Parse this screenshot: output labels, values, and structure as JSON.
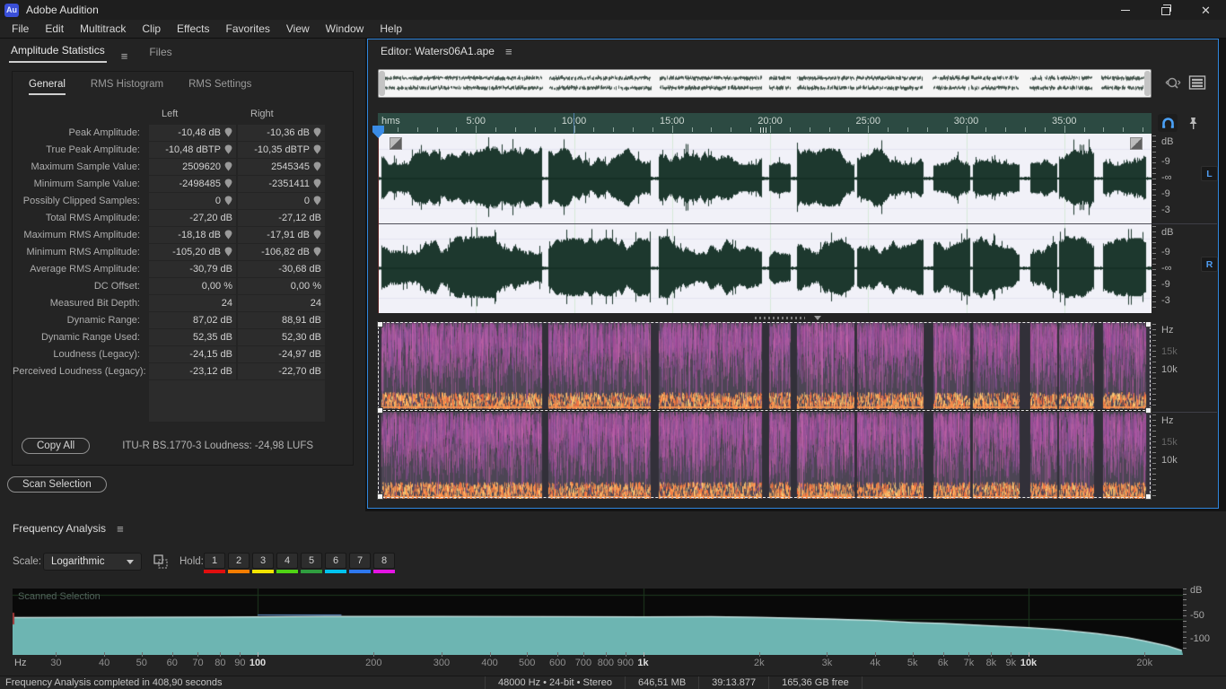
{
  "window": {
    "logo": "Au",
    "title": "Adobe Audition"
  },
  "menu": {
    "items": [
      "File",
      "Edit",
      "Multitrack",
      "Clip",
      "Effects",
      "Favorites",
      "View",
      "Window",
      "Help"
    ]
  },
  "stats_panel": {
    "tabs": [
      {
        "label": "Amplitude Statistics",
        "active": true
      },
      {
        "label": "Files",
        "active": false
      }
    ],
    "inner_tabs": [
      {
        "label": "General",
        "active": true
      },
      {
        "label": "RMS Histogram",
        "active": false
      },
      {
        "label": "RMS Settings",
        "active": false
      }
    ],
    "columns": {
      "left": "Left",
      "right": "Right"
    },
    "rows": [
      {
        "label": "Peak Amplitude:",
        "left": "-10,48 dB",
        "right": "-10,36 dB",
        "pins": true
      },
      {
        "label": "True Peak Amplitude:",
        "left": "-10,48 dBTP",
        "right": "-10,35 dBTP",
        "pins": true
      },
      {
        "label": "Maximum Sample Value:",
        "left": "2509620",
        "right": "2545345",
        "pins": true
      },
      {
        "label": "Minimum Sample Value:",
        "left": "-2498485",
        "right": "-2351411",
        "pins": true
      },
      {
        "label": "Possibly Clipped Samples:",
        "left": "0",
        "right": "0",
        "pins": true
      },
      {
        "label": "Total RMS Amplitude:",
        "left": "-27,20 dB",
        "right": "-27,12 dB",
        "pins": false
      },
      {
        "label": "Maximum RMS Amplitude:",
        "left": "-18,18 dB",
        "right": "-17,91 dB",
        "pins": true
      },
      {
        "label": "Minimum RMS Amplitude:",
        "left": "-105,20 dB",
        "right": "-106,82 dB",
        "pins": true
      },
      {
        "label": "Average RMS Amplitude:",
        "left": "-30,79 dB",
        "right": "-30,68 dB",
        "pins": false
      },
      {
        "label": "DC Offset:",
        "left": "0,00 %",
        "right": "0,00 %",
        "pins": false
      },
      {
        "label": "Measured Bit Depth:",
        "left": "24",
        "right": "24",
        "pins": false
      },
      {
        "label": "Dynamic Range:",
        "left": "87,02 dB",
        "right": "88,91 dB",
        "pins": false
      },
      {
        "label": "Dynamic Range Used:",
        "left": "52,35 dB",
        "right": "52,30 dB",
        "pins": false
      },
      {
        "label": "Loudness (Legacy):",
        "left": "-24,15 dB",
        "right": "-24,97 dB",
        "pins": false
      },
      {
        "label": "Perceived Loudness (Legacy):",
        "left": "-23,12 dB",
        "right": "-22,70 dB",
        "pins": false
      }
    ],
    "copy_all_label": "Copy All",
    "loudness_note": "ITU-R BS.1770-3 Loudness:  -24,98 LUFS",
    "scan_selection_label": "Scan Selection"
  },
  "editor": {
    "title": "Editor: Waters06A1.ape",
    "duration_min": 39.45,
    "timeline": {
      "unit": "hms",
      "major_labels": [
        "5:00",
        "10:00",
        "15:00",
        "20:00",
        "25:00",
        "30:00",
        "35:00"
      ]
    },
    "wave_scale": {
      "unit": "dB",
      "labels": [
        "-9",
        "-∞",
        "-9",
        "-3"
      ]
    },
    "channels": [
      "L",
      "R"
    ],
    "spectral_scale": {
      "unit": "Hz",
      "labels": [
        {
          "text": "15k",
          "dim": true
        },
        {
          "text": "10k",
          "dim": false
        }
      ]
    },
    "waveform_segments": [
      [
        0.15,
        8.35,
        0.85
      ],
      [
        8.65,
        13.9,
        0.8
      ],
      [
        14.3,
        19.55,
        0.85
      ],
      [
        19.95,
        21.05,
        0.5
      ],
      [
        21.35,
        24.3,
        0.8
      ],
      [
        24.4,
        27.8,
        0.85
      ],
      [
        28.3,
        30.2,
        0.8
      ],
      [
        30.3,
        32.7,
        0.85
      ],
      [
        33.25,
        34.6,
        0.75
      ],
      [
        34.7,
        36.5,
        0.85
      ],
      [
        36.95,
        39.15,
        0.8
      ]
    ]
  },
  "frequency_panel": {
    "title": "Frequency Analysis",
    "scale_label": "Scale:",
    "scale_value": "Logarithmic",
    "hold_label": "Hold:",
    "hold_buttons": [
      {
        "n": "1",
        "color": "#e10e0e"
      },
      {
        "n": "2",
        "color": "#f57d00"
      },
      {
        "n": "3",
        "color": "#f2e400"
      },
      {
        "n": "4",
        "color": "#4fd414"
      },
      {
        "n": "5",
        "color": "#2f9e3f"
      },
      {
        "n": "6",
        "color": "#00c3ef"
      },
      {
        "n": "7",
        "color": "#2e78ef"
      },
      {
        "n": "8",
        "color": "#e414e4"
      }
    ],
    "graph_label": "Scanned Selection",
    "db_axis": [
      "dB",
      "-50",
      "-100"
    ],
    "hz_label": "Hz",
    "freq_ticks": [
      {
        "label": "30",
        "f": 30
      },
      {
        "label": "40",
        "f": 40
      },
      {
        "label": "50",
        "f": 50
      },
      {
        "label": "60",
        "f": 60
      },
      {
        "label": "70",
        "f": 70
      },
      {
        "label": "80",
        "f": 80
      },
      {
        "label": "90",
        "f": 90
      },
      {
        "label": "100",
        "f": 100,
        "major": true
      },
      {
        "label": "200",
        "f": 200
      },
      {
        "label": "300",
        "f": 300
      },
      {
        "label": "400",
        "f": 400
      },
      {
        "label": "500",
        "f": 500
      },
      {
        "label": "600",
        "f": 600
      },
      {
        "label": "700",
        "f": 700
      },
      {
        "label": "800",
        "f": 800
      },
      {
        "label": "900",
        "f": 900
      },
      {
        "label": "1k",
        "f": 1000,
        "major": true
      },
      {
        "label": "2k",
        "f": 2000
      },
      {
        "label": "3k",
        "f": 3000
      },
      {
        "label": "4k",
        "f": 4000
      },
      {
        "label": "5k",
        "f": 5000
      },
      {
        "label": "6k",
        "f": 6000
      },
      {
        "label": "7k",
        "f": 7000
      },
      {
        "label": "8k",
        "f": 8000
      },
      {
        "label": "9k",
        "f": 9000
      },
      {
        "label": "10k",
        "f": 10000,
        "major": true
      },
      {
        "label": "20k",
        "f": 20000
      }
    ],
    "chart_data": {
      "type": "area",
      "title": "Frequency Analysis (Scanned Selection)",
      "xlabel": "Hz",
      "ylabel": "dB",
      "x_scale": "log",
      "xlim": [
        23,
        25000
      ],
      "ylim": [
        -120,
        0
      ],
      "series": [
        {
          "name": "Scanned Selection",
          "points": [
            [
              23,
              -47
            ],
            [
              40,
              -46.5
            ],
            [
              80,
              -46
            ],
            [
              100,
              -45.5
            ],
            [
              150,
              -44.5
            ],
            [
              300,
              -44.5
            ],
            [
              600,
              -45
            ],
            [
              1000,
              -45.5
            ],
            [
              1500,
              -45
            ],
            [
              2000,
              -46.5
            ],
            [
              3000,
              -50
            ],
            [
              4000,
              -53
            ],
            [
              5000,
              -57
            ],
            [
              6000,
              -59
            ],
            [
              8000,
              -64
            ],
            [
              10000,
              -68
            ],
            [
              12000,
              -72
            ],
            [
              15000,
              -80
            ],
            [
              18000,
              -88
            ],
            [
              20000,
              -95
            ],
            [
              23000,
              -106
            ],
            [
              25000,
              -115
            ]
          ]
        }
      ]
    }
  },
  "status_bar": {
    "message": "Frequency Analysis completed in 408,90 seconds",
    "format": "48000 Hz • 24-bit • Stereo",
    "file_size": "646,51 MB",
    "duration": "39:13.877",
    "free_space": "165,36 GB free"
  }
}
